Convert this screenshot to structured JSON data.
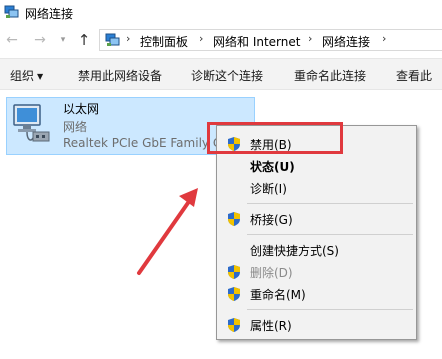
{
  "window": {
    "title": "网络连接"
  },
  "address": {
    "back_icon": "←",
    "forward_icon": "→",
    "dropdown_icon": "▾",
    "up_icon": "↑",
    "separator": "›",
    "crumbs": [
      "控制面板",
      "网络和 Internet",
      "网络连接"
    ]
  },
  "toolbar": {
    "organize_label": "组织",
    "organize_arrow": "▼",
    "disable_device_label": "禁用此网络设备",
    "diagnose_label": "诊断这个连接",
    "rename_label": "重命名此连接",
    "view_status_label": "查看此"
  },
  "network_item": {
    "name": "以太网",
    "type": "网络",
    "adapter": "Realtek PCIe GbE Family C"
  },
  "context_menu": {
    "items": [
      {
        "label": "禁用(B)",
        "icon": "shield-icon",
        "bold": false,
        "disabled": false
      },
      {
        "label": "状态(U)",
        "icon": "",
        "bold": true,
        "disabled": false
      },
      {
        "label": "诊断(I)",
        "icon": "",
        "bold": false,
        "disabled": false
      },
      {
        "label": "桥接(G)",
        "icon": "shield-icon",
        "bold": false,
        "disabled": false
      },
      {
        "label": "创建快捷方式(S)",
        "icon": "",
        "bold": false,
        "disabled": false
      },
      {
        "label": "删除(D)",
        "icon": "shield-icon",
        "bold": false,
        "disabled": true
      },
      {
        "label": "重命名(M)",
        "icon": "shield-icon",
        "bold": false,
        "disabled": false
      },
      {
        "label": "属性(R)",
        "icon": "shield-icon",
        "bold": false,
        "disabled": false
      }
    ]
  },
  "annotation": {
    "highlight_color": "#e0393e",
    "arrow_color": "#e0393e"
  },
  "colors": {
    "selection_bg": "#cce8ff",
    "selection_border": "#99d1ff",
    "toolbar_bg": "#f3f3f3",
    "menu_bg": "#f2f2f2"
  }
}
